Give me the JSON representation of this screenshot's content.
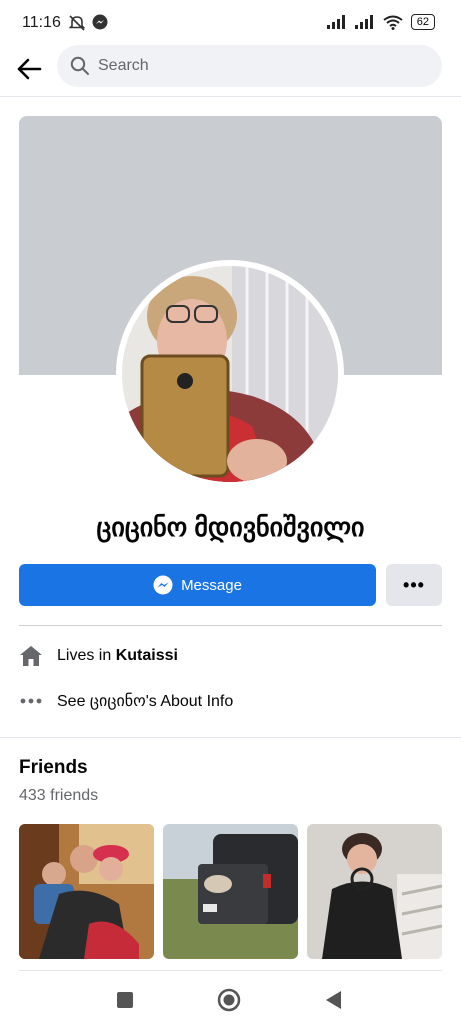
{
  "status_bar": {
    "time": "11:16",
    "battery": "62"
  },
  "search": {
    "placeholder": "Search"
  },
  "profile": {
    "name": "ციცინო მდივნიშვილი"
  },
  "actions": {
    "message_label": "Message",
    "more_label": "•••"
  },
  "info": {
    "lives_prefix": "Lives in ",
    "lives_city": "Kutaissi",
    "about_text": "See ციცინო's About Info"
  },
  "friends": {
    "title": "Friends",
    "count": "433 friends"
  },
  "colors": {
    "accent": "#1b74e4",
    "cover": "#c9ccd1"
  }
}
